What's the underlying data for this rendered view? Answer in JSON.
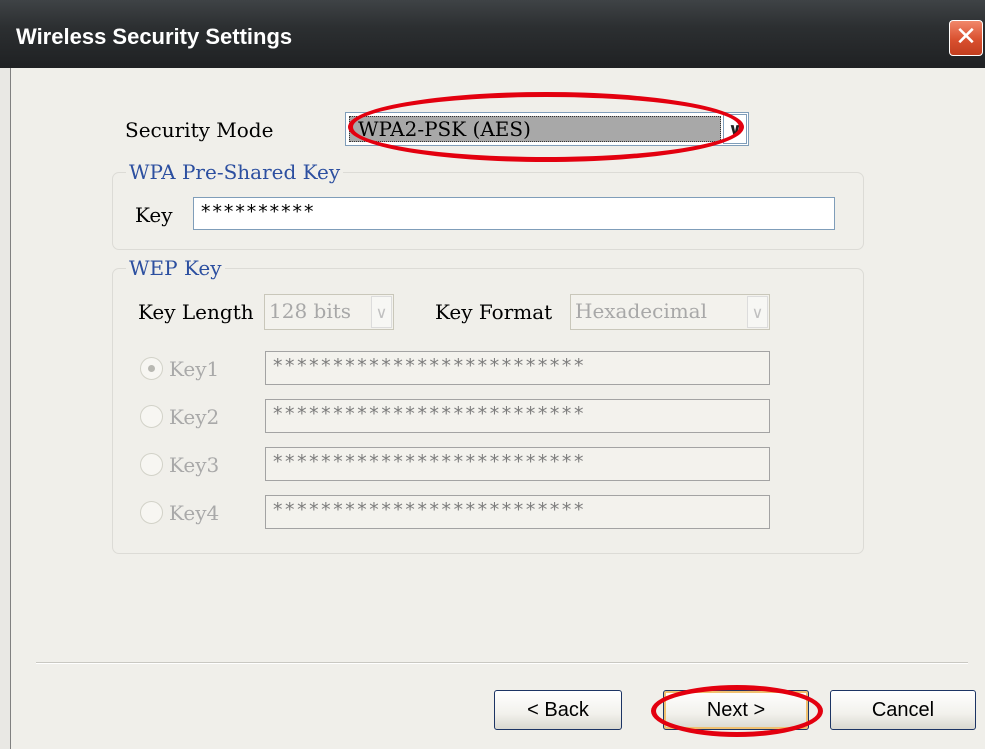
{
  "window": {
    "title": "Wireless Security Settings",
    "close_glyph": "✕"
  },
  "security": {
    "label": "Security Mode",
    "selected": "WPA2-PSK (AES)",
    "arrow_glyph": "∨"
  },
  "wpa_group": {
    "title": "WPA Pre-Shared Key",
    "key_label": "Key",
    "key_value": "**********"
  },
  "wep_group": {
    "title": "WEP Key",
    "key_length_label": "Key Length",
    "key_length_value": "128 bits",
    "key_format_label": "Key Format",
    "key_format_value": "Hexadecimal",
    "arrow_glyph": "∨",
    "keys": [
      {
        "label": "Key1",
        "value": "**************************",
        "checked": true
      },
      {
        "label": "Key2",
        "value": "**************************",
        "checked": false
      },
      {
        "label": "Key3",
        "value": "**************************",
        "checked": false
      },
      {
        "label": "Key4",
        "value": "**************************",
        "checked": false
      }
    ]
  },
  "buttons": {
    "back": "< Back",
    "next": "Next >",
    "cancel": "Cancel"
  },
  "colors": {
    "annotation_red": "#e3000f",
    "group_title_blue": "#2c4fa0",
    "dialog_background": "#f0efea",
    "titlebar": "#2c2f31"
  }
}
